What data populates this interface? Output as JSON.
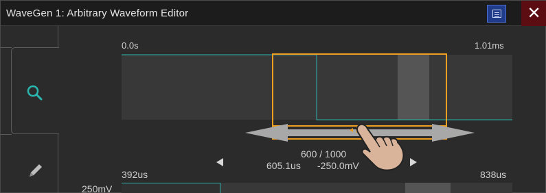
{
  "window": {
    "title": "WaveGen 1: Arbitrary Waveform Editor"
  },
  "toolbar": {
    "menu_icon": "menu-icon",
    "close_label": "✕"
  },
  "sidebar": {
    "items": [
      {
        "icon": "zoom-icon",
        "selected": true
      },
      {
        "icon": "pencil-icon",
        "selected": false
      }
    ]
  },
  "overview": {
    "start_label": "0.0s",
    "end_label": "1.01ms"
  },
  "info": {
    "point_index": "600 / 1000",
    "time_value": "605.1us",
    "voltage_value": "-250.0mV"
  },
  "detail": {
    "start_label": "392us",
    "end_label": "838us",
    "y_label": "250mV"
  },
  "colors": {
    "waveform": "#2ab7b0",
    "selection": "#f0a020",
    "window_bg": "#2b2b2b",
    "titlebar_bg": "#1c1c1c",
    "close_bg": "#5b0d12",
    "menu_bg": "#1f3b8a"
  }
}
